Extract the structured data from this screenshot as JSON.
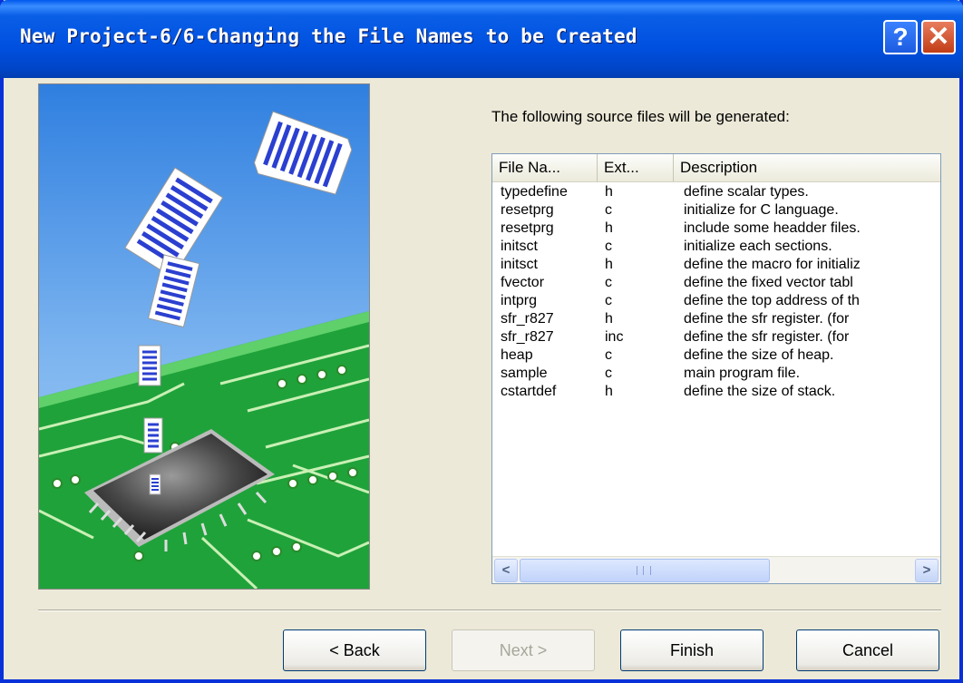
{
  "window": {
    "title": "New Project-6/6-Changing the File Names to be Created",
    "help_label": "?",
    "close_label": "✕"
  },
  "instructions": "The following source files will be generated:",
  "listview": {
    "columns": [
      "File Na...",
      "Ext...",
      "Description"
    ],
    "rows": [
      {
        "name": "typedefine",
        "ext": "h",
        "desc": "define scalar types."
      },
      {
        "name": "resetprg",
        "ext": "c",
        "desc": "initialize for C language."
      },
      {
        "name": "resetprg",
        "ext": "h",
        "desc": "include some headder files."
      },
      {
        "name": "initsct",
        "ext": "c",
        "desc": "initialize each sections."
      },
      {
        "name": "initsct",
        "ext": "h",
        "desc": "define the macro for initializ"
      },
      {
        "name": "fvector",
        "ext": "c",
        "desc": "define the fixed vector tabl"
      },
      {
        "name": "intprg",
        "ext": "c",
        "desc": "define the top address of th"
      },
      {
        "name": "sfr_r827",
        "ext": "h",
        "desc": "define the sfr register. (for"
      },
      {
        "name": "sfr_r827",
        "ext": "inc",
        "desc": "define the sfr register. (for"
      },
      {
        "name": "heap",
        "ext": "c",
        "desc": "define the size of heap."
      },
      {
        "name": "sample",
        "ext": "c",
        "desc": "main program file."
      },
      {
        "name": "cstartdef",
        "ext": "h",
        "desc": "define the size of stack."
      }
    ],
    "scroll_left": "<",
    "scroll_right": ">"
  },
  "buttons": {
    "back": "< Back",
    "next": "Next >",
    "finish": "Finish",
    "cancel": "Cancel"
  }
}
